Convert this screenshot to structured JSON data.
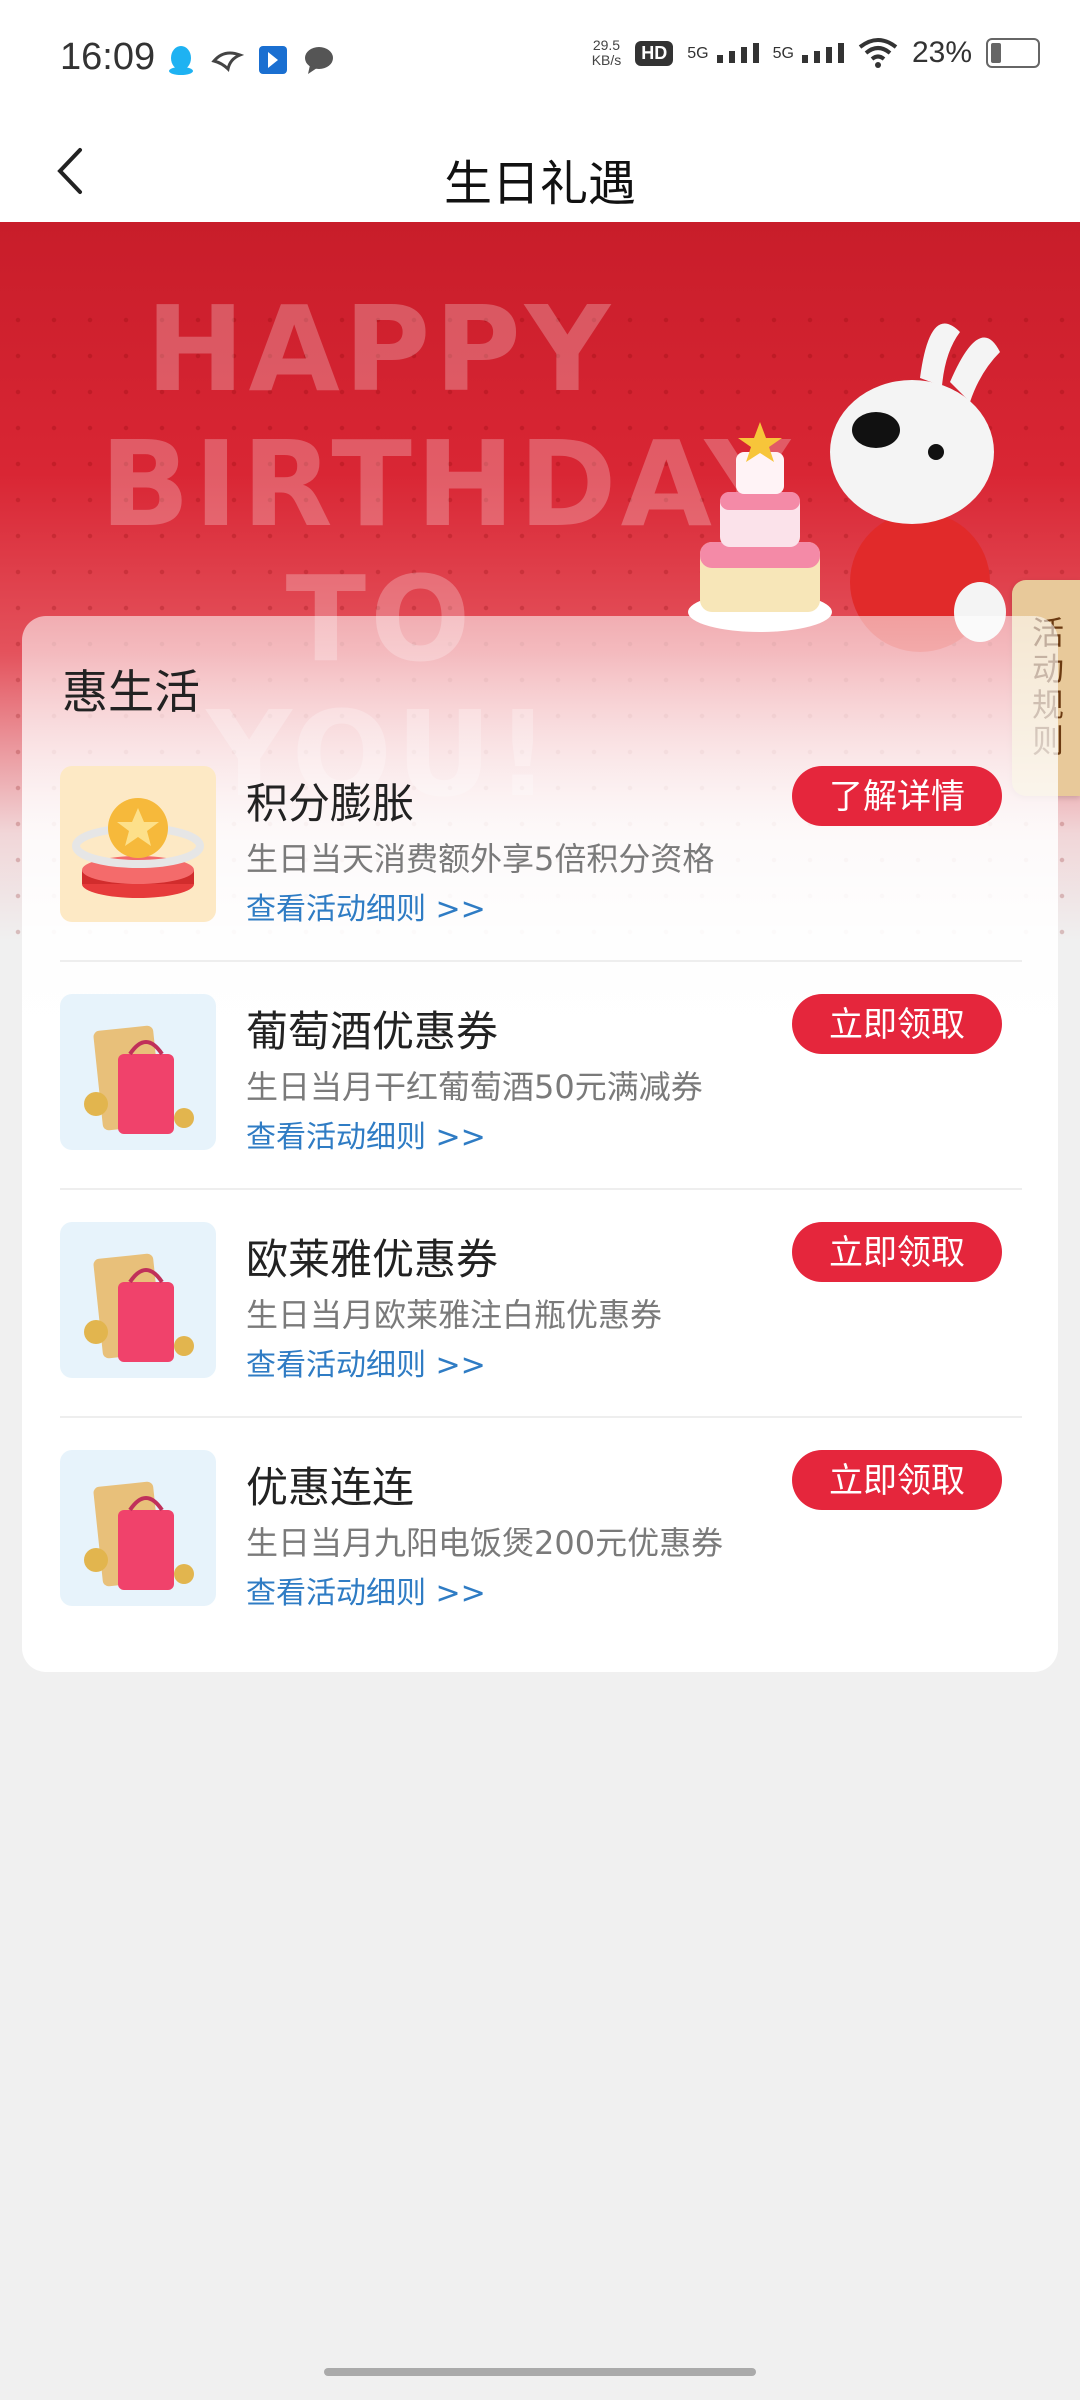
{
  "status_bar": {
    "time": "16:09",
    "net_speed_value": "29.5",
    "net_speed_unit": "KB/s",
    "hd_badge": "HD",
    "sim1": "5G",
    "sim2": "5G",
    "battery_percent": "23%"
  },
  "header": {
    "title": "生日礼遇"
  },
  "hero": {
    "line1": "HAPPY",
    "line2": "BIRTHDAY",
    "line3": "TO YOU!",
    "rules_tab": "活动规则"
  },
  "section": {
    "title": "惠生活",
    "items": [
      {
        "title": "积分膨胀",
        "desc": "生日当天消费额外享5倍积分资格",
        "link": "查看活动细则 >>",
        "button": "了解详情",
        "thumb_icon": "coin-stage-icon"
      },
      {
        "title": "葡萄酒优惠券",
        "desc": "生日当月干红葡萄酒50元满减券",
        "link": "查看活动细则 >>",
        "button": "立即领取",
        "thumb_icon": "shopping-bag-coupon-icon"
      },
      {
        "title": "欧莱雅优惠券",
        "desc": "生日当月欧莱雅注白瓶优惠券",
        "link": "查看活动细则 >>",
        "button": "立即领取",
        "thumb_icon": "shopping-bag-coupon-icon"
      },
      {
        "title": "优惠连连",
        "desc": "生日当月九阳电饭煲200元优惠券",
        "link": "查看活动细则 >>",
        "button": "立即领取",
        "thumb_icon": "shopping-bag-coupon-icon"
      }
    ]
  },
  "colors": {
    "accent": "#e5263c",
    "link": "#2f7cc4",
    "hero_red": "#c81d2a"
  }
}
